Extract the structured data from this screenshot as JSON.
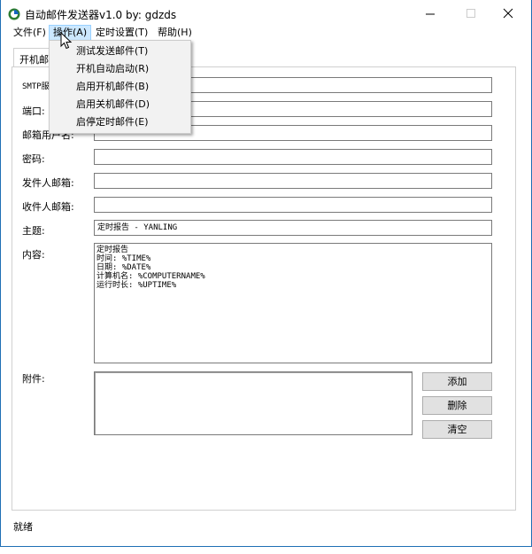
{
  "window": {
    "title": "自动邮件发送器v1.0  by: gdzds",
    "accent": "#1f6fb5"
  },
  "menubar": {
    "file": "文件(F)",
    "operate": "操作(A)",
    "timer": "定时设置(T)",
    "help": "帮助(H)"
  },
  "operate_menu": {
    "items": [
      "测试发送邮件(T)",
      "开机自动启动(R)",
      "启用开机邮件(B)",
      "启用关机邮件(D)",
      "启停定时邮件(E)"
    ]
  },
  "tab": {
    "label": "开机邮"
  },
  "form": {
    "smtp_label": "SMTP服",
    "smtp_value": "",
    "port_label": "端口:",
    "port_value": "",
    "user_label": "邮箱用户名:",
    "user_value": "",
    "password_label": "密码:",
    "password_value": "",
    "sender_label": "发件人邮箱:",
    "sender_value": "",
    "recipient_label": "收件人邮箱:",
    "recipient_value": "",
    "subject_label": "主题:",
    "subject_value": "定时报告 - YANLING",
    "content_label": "内容:",
    "content_value": "定时报告\n时间: %TIME%\n日期: %DATE%\n计算机名: %COMPUTERNAME%\n运行时长: %UPTIME%",
    "attachment_label": "附件:"
  },
  "buttons": {
    "add": "添加",
    "delete": "删除",
    "clear": "清空"
  },
  "status": {
    "text": "就绪"
  }
}
